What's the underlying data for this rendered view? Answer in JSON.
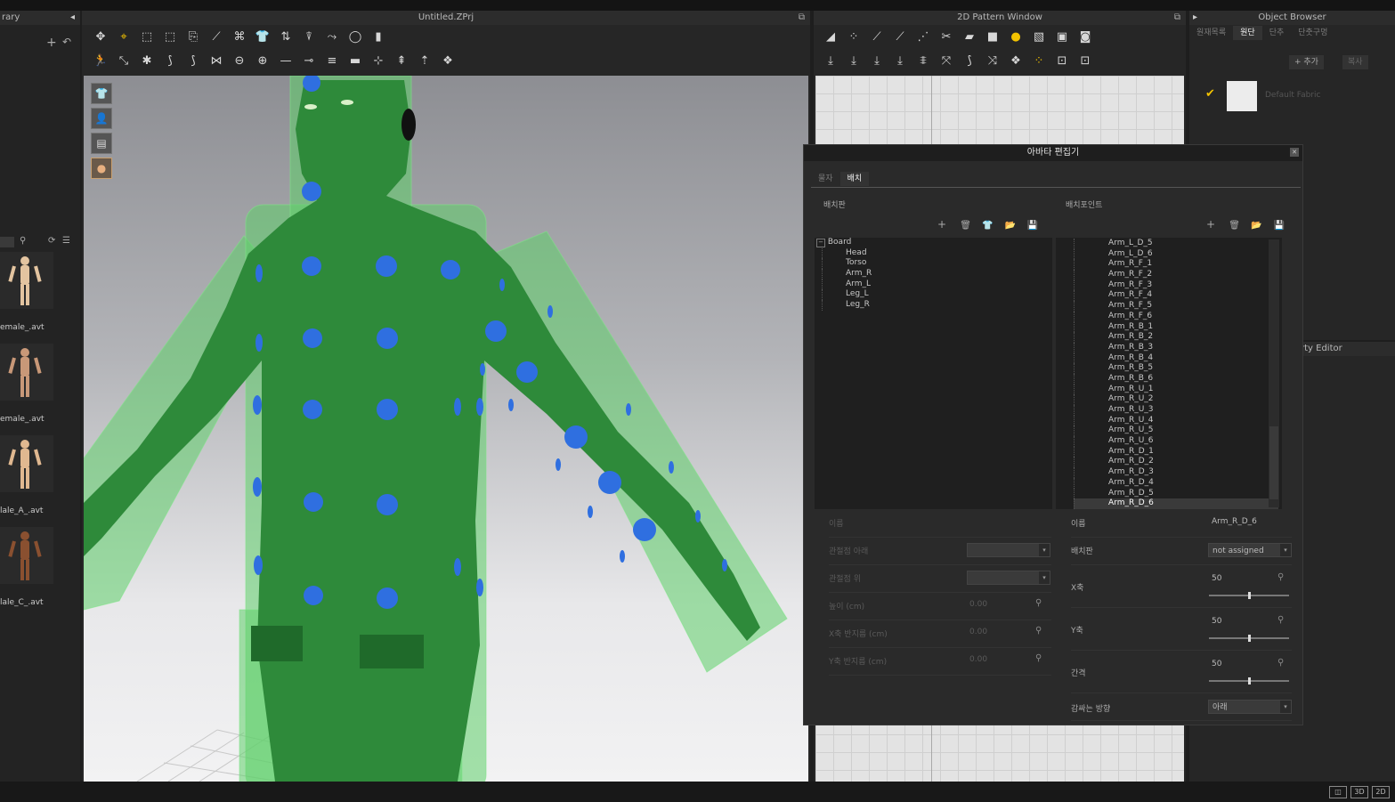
{
  "library": {
    "title": "rary",
    "thumbnails": [
      {
        "label": "emale_.avt",
        "color": "#e3c4a0"
      },
      {
        "label": "emale_.avt",
        "color": "#c89878"
      },
      {
        "label": "lale_A_.avt",
        "color": "#e0b890"
      },
      {
        "label": "lale_C_.avt",
        "color": "#8a5030"
      }
    ]
  },
  "viewport3d": {
    "title": "Untitled.ZPrj",
    "side_icons": [
      "garment-icon",
      "avatar-icon",
      "pattern-icon",
      "skin-icon"
    ]
  },
  "pattern_window": {
    "title": "2D Pattern Window"
  },
  "object_browser": {
    "title": "Object Browser",
    "tabs": [
      "원재목록",
      "원단",
      "단추",
      "단춧구멍"
    ],
    "active_tab": 1,
    "add_label": "+ 추가",
    "copy_label": "복사",
    "fabric_name": "Default Fabric"
  },
  "property_editor": {
    "title": "rty Editor"
  },
  "avatar_editor": {
    "title": "아바타 편집기",
    "tabs": [
      "물자",
      "배치"
    ],
    "active_tab": 1,
    "board_header": "배치판",
    "points_header": "배치포인트",
    "board_tree": {
      "root": "Board",
      "children": [
        "Head",
        "Torso",
        "Arm_R",
        "Arm_L",
        "Leg_L",
        "Leg_R"
      ]
    },
    "points_list": [
      "Arm_L_D_5",
      "Arm_L_D_6",
      "Arm_R_F_1",
      "Arm_R_F_2",
      "Arm_R_F_3",
      "Arm_R_F_4",
      "Arm_R_F_5",
      "Arm_R_F_6",
      "Arm_R_B_1",
      "Arm_R_B_2",
      "Arm_R_B_3",
      "Arm_R_B_4",
      "Arm_R_B_5",
      "Arm_R_B_6",
      "Arm_R_U_1",
      "Arm_R_U_2",
      "Arm_R_U_3",
      "Arm_R_U_4",
      "Arm_R_U_5",
      "Arm_R_U_6",
      "Arm_R_D_1",
      "Arm_R_D_2",
      "Arm_R_D_3",
      "Arm_R_D_4",
      "Arm_R_D_5",
      "Arm_R_D_6"
    ],
    "selected_point": "Arm_R_D_6",
    "left_props": {
      "name_label": "이름",
      "joint_below_label": "관절점 아래",
      "joint_above_label": "관절점 위",
      "height_label": "높이 (cm)",
      "height_value": "0.00",
      "x_radius_label": "X축 반지름 (cm)",
      "x_radius_value": "0.00",
      "y_radius_label": "Y축 반지름 (cm)",
      "y_radius_value": "0.00"
    },
    "right_props": {
      "name_label": "이름",
      "name_value": "Arm_R_D_6",
      "board_label": "배치판",
      "board_value": "not assigned",
      "x_label": "X축",
      "x_value": "50",
      "y_label": "Y축",
      "y_value": "50",
      "gap_label": "간격",
      "gap_value": "50",
      "wrap_label": "감싸는 방향",
      "wrap_value": "아래"
    }
  },
  "status_bar": {
    "view_buttons": [
      "◫",
      "3D",
      "2D"
    ]
  },
  "colors": {
    "accent_yellow": "#f2c200",
    "point_blue": "#2f6fe0",
    "avatar_green": "#2e8a3a"
  }
}
